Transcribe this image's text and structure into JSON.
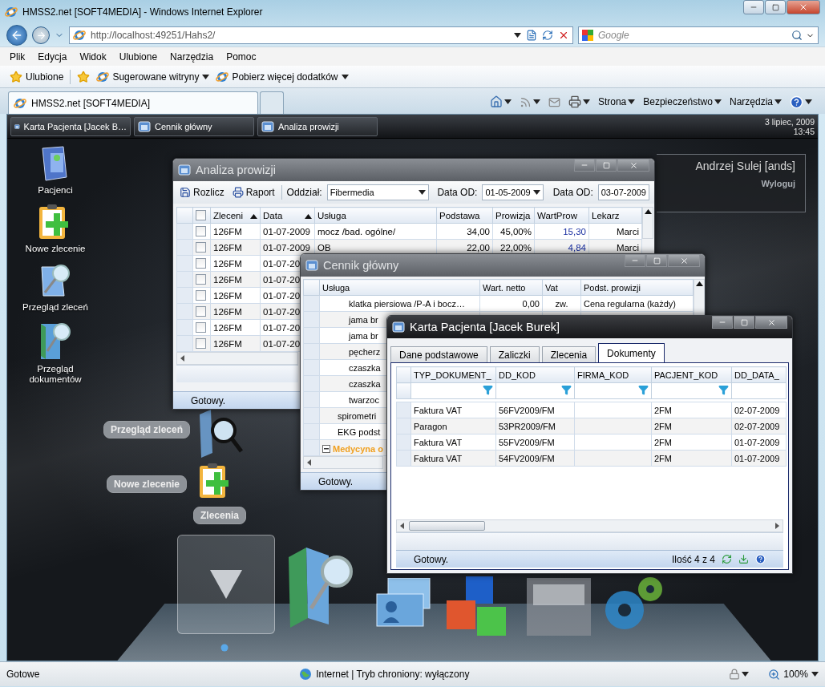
{
  "browser": {
    "title": "HMSS2.net [SOFT4MEDIA] - Windows Internet Explorer",
    "address": "http://localhost:49251/Hahs2/",
    "search_placeholder": "Google",
    "menu": [
      "Plik",
      "Edycja",
      "Widok",
      "Ulubione",
      "Narzędzia",
      "Pomoc"
    ],
    "favorites": {
      "label": "Ulubione",
      "links": [
        "Sugerowane witryny",
        "Pobierz więcej dodatków"
      ]
    },
    "tabs": [
      {
        "label": "HMSS2.net [SOFT4MEDIA]",
        "selected": true
      }
    ],
    "commands": [
      "Strona",
      "Bezpieczeństwo",
      "Narzędzia"
    ],
    "status": {
      "text": "Gotowe",
      "zone": "Internet | Tryb chroniony: wyłączony",
      "zoom": "100%"
    }
  },
  "app": {
    "taskbar": {
      "items": [
        "Karta Pacjenta [Jacek B…",
        "Cennik główny",
        "Analiza prowizji"
      ],
      "date": "3 lipiec, 2009",
      "time": "13:45"
    },
    "user": {
      "name": "Andrzej Sulej [ands]",
      "logout": "Wyloguj"
    },
    "desktop_icons": [
      {
        "label": "Pacjenci",
        "kind": "patients"
      },
      {
        "label": "Nowe zlecenie",
        "kind": "new_order"
      },
      {
        "label": "Przegląd zleceń",
        "kind": "orders"
      },
      {
        "label": "Przegląd dokumentów",
        "kind": "documents"
      }
    ],
    "dock_labels": [
      "Przegląd zleceń",
      "Nowe zlecenie",
      "Zlecenia"
    ],
    "commission": {
      "title": "Analiza prowizji",
      "active": false,
      "toolbar": {
        "buttons": [
          "Rozlicz",
          "Raport"
        ],
        "branch_label": "Oddział:",
        "branch": "Fibermedia",
        "from_label": "Data OD:",
        "from": "01-05-2009",
        "to_label": "Data OD:",
        "to": "03-07-2009"
      },
      "all_checked": false,
      "columns": [
        {
          "label": "Zleceni",
          "sorted": true
        },
        {
          "label": "Data",
          "sorted": true
        },
        {
          "label": "Usługa",
          "sorted": false
        },
        {
          "label": "Podstawa",
          "sorted": false
        },
        {
          "label": "Prowizja",
          "sorted": false
        },
        {
          "label": "WartProw",
          "sorted": false
        },
        {
          "label": "Lekarz",
          "sorted": false
        }
      ],
      "rows": [
        {
          "checked": false,
          "cells": [
            "126FM",
            "01-07-2009",
            "mocz /bad. ogólne/",
            "34,00",
            "45,00%",
            "15,30",
            "Marci"
          ]
        },
        {
          "checked": false,
          "cells": [
            "126FM",
            "01-07-2009",
            "OB",
            "22,00",
            "22,00%",
            "4,84",
            "Marci"
          ]
        },
        {
          "checked": false,
          "cells": [
            "126FM",
            "01-07-20"
          ]
        },
        {
          "checked": false,
          "cells": [
            "126FM",
            "01-07-20"
          ]
        },
        {
          "checked": false,
          "cells": [
            "126FM",
            "01-07-20"
          ]
        },
        {
          "checked": false,
          "cells": [
            "126FM",
            "01-07-20"
          ]
        },
        {
          "checked": false,
          "cells": [
            "126FM",
            "01-07-20"
          ]
        },
        {
          "checked": false,
          "cells": [
            "126FM",
            "01-07-20"
          ]
        }
      ],
      "status": "Gotowy."
    },
    "pricelist": {
      "title": "Cennik główny",
      "active": false,
      "columns": [
        "Usługa",
        "Wart. netto",
        "Vat",
        "Podst. prowizji"
      ],
      "tree": [
        {
          "children": [
            {
              "children": [
                {
                  "label": "klatka piersiowa /P-A i bocz…",
                  "net": "0,00",
                  "vat": "zw.",
                  "basis": "Cena regularna (każdy)"
                },
                {
                  "label": "jama br"
                },
                {
                  "label": "jama br"
                },
                {
                  "label": "pęcherz"
                },
                {
                  "label": "czaszka"
                },
                {
                  "label": "czaszka"
                },
                {
                  "label": "twarzoc"
                }
              ]
            },
            {
              "label": "spirometri"
            },
            {
              "label": "EKG podst"
            }
          ]
        },
        {
          "label": "Medycyna o",
          "kind": "group",
          "expanded": true
        }
      ],
      "status": "Gotowy."
    },
    "patient": {
      "title": "Karta Pacjenta [Jacek Burek]",
      "active": true,
      "tabs": [
        {
          "label": "Dane podstawowe",
          "selected": false
        },
        {
          "label": "Zaliczki",
          "selected": false
        },
        {
          "label": "Zlecenia",
          "selected": false
        },
        {
          "label": "Dokumenty",
          "selected": true
        }
      ],
      "columns": [
        {
          "label": "TYP_DOKUMENT_",
          "filter": true
        },
        {
          "label": "DD_KOD",
          "filter": true
        },
        {
          "label": "FIRMA_KOD",
          "filter": true
        },
        {
          "label": "PACJENT_KOD",
          "filter": true
        },
        {
          "label": "DD_DATA_",
          "filter": false
        }
      ],
      "rows": [
        {
          "type": "Faktura VAT",
          "code": "56FV2009/FM",
          "patient": "2FM",
          "date": "02-07-2009"
        },
        {
          "type": "Paragon",
          "code": "53PR2009/FM",
          "patient": "2FM",
          "date": "02-07-2009"
        },
        {
          "type": "Faktura VAT",
          "code": "55FV2009/FM",
          "patient": "2FM",
          "date": "01-07-2009"
        },
        {
          "type": "Faktura VAT",
          "code": "54FV2009/FM",
          "patient": "2FM",
          "date": "01-07-2009"
        }
      ],
      "status": "Gotowy.",
      "count": "Ilość 4 z 4"
    }
  }
}
